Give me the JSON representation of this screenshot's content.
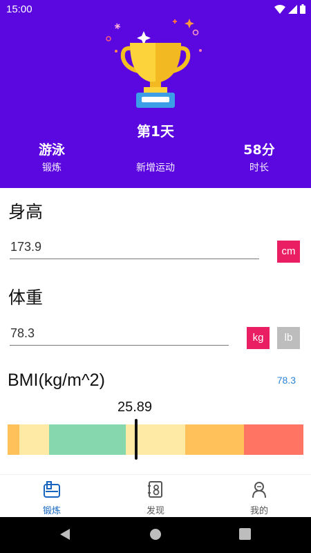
{
  "status": {
    "time": "15:00"
  },
  "header": {
    "day": "第1天",
    "stats": [
      {
        "value": "游泳",
        "label": "锻炼"
      },
      {
        "value": "",
        "label": "新增运动"
      },
      {
        "value": "58分",
        "label": "时长"
      }
    ]
  },
  "height": {
    "title": "身高",
    "value": "173.9",
    "unit": "cm"
  },
  "weight": {
    "title": "体重",
    "value": "78.3",
    "unit_kg": "kg",
    "unit_lb": "lb"
  },
  "bmi": {
    "title": "BMI(kg/m^2)",
    "weight_readout": "78.3",
    "value": "25.89",
    "value_num": 25.89,
    "scale_min": 15,
    "scale_max": 40,
    "segments": [
      {
        "from": 15,
        "to": 16,
        "color": "#ffc25a"
      },
      {
        "from": 16,
        "to": 18.5,
        "color": "#ffeaa5"
      },
      {
        "from": 18.5,
        "to": 25,
        "color": "#86d7ad"
      },
      {
        "from": 25,
        "to": 30,
        "color": "#ffeaa5"
      },
      {
        "from": 30,
        "to": 35,
        "color": "#ffc25a"
      },
      {
        "from": 35,
        "to": 40,
        "color": "#ff7463"
      }
    ]
  },
  "nav": [
    {
      "label": "锻炼",
      "icon": "exercise-icon",
      "active": true
    },
    {
      "label": "发现",
      "icon": "discover-icon",
      "active": false
    },
    {
      "label": "我的",
      "icon": "profile-icon",
      "active": false
    }
  ],
  "colors": {
    "header": "#5b07e0",
    "accent": "#e91e63",
    "nav_active": "#1565c0"
  }
}
